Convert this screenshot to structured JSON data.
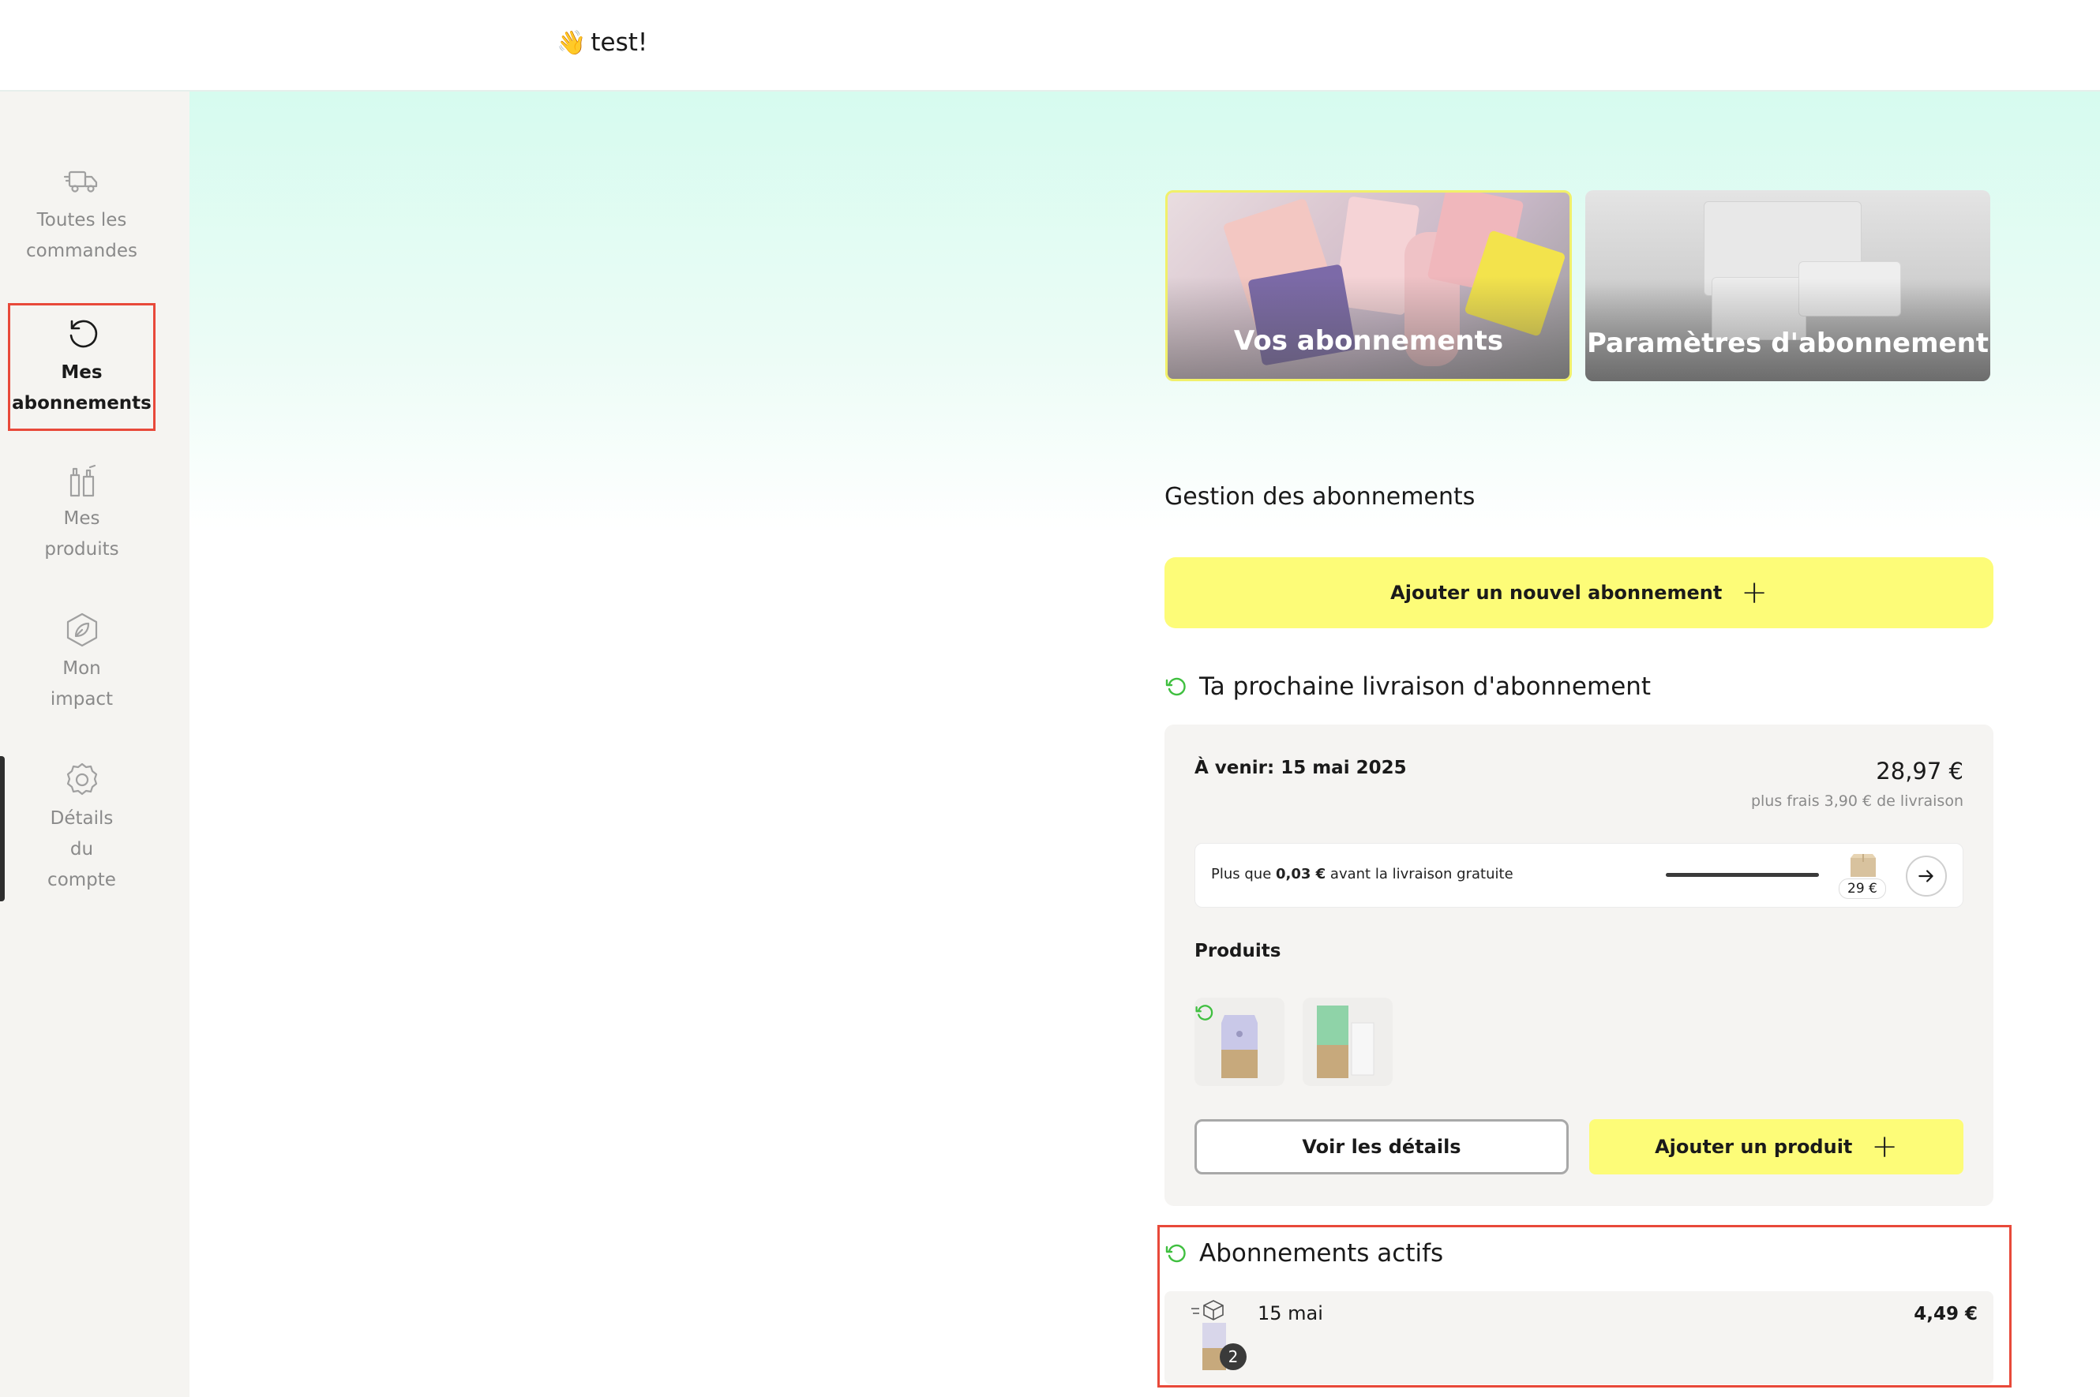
{
  "header": {
    "wave_emoji": "👋",
    "greeting": "test!"
  },
  "sidebar": {
    "items": [
      {
        "label": "Toutes les\ncommandes",
        "icon": "truck-icon",
        "active": false
      },
      {
        "label": "Mes\nabonnements",
        "icon": "refresh-icon",
        "active": true
      },
      {
        "label": "Mes\nproduits",
        "icon": "bottles-icon",
        "active": false
      },
      {
        "label": "Mon\nimpact",
        "icon": "leaf-icon",
        "active": false
      },
      {
        "label": "Détails\ndu\ncompte",
        "icon": "gear-icon",
        "active": false
      }
    ]
  },
  "hero_cards": [
    {
      "title": "Vos abonnements"
    },
    {
      "title": "Paramètres d'abonnement"
    }
  ],
  "management": {
    "title": "Gestion des abonnements",
    "add_subscription_label": "Ajouter un nouvel abonnement",
    "plus": "+"
  },
  "next_delivery": {
    "heading": "Ta prochaine livraison d'abonnement",
    "upcoming": "À venir: 15 mai 2025",
    "price": "28,97 €",
    "fees": "plus frais 3,90 € de livraison",
    "free_shipping": {
      "prefix": "Plus que ",
      "amount": "0,03 €",
      "suffix": " avant la livraison gratuite",
      "threshold": "29 €",
      "progress": 0.999
    },
    "products_label": "Produits",
    "view_details_label": "Voir les détails",
    "add_product_label": "Ajouter un produit"
  },
  "active_subscriptions": {
    "heading": "Abonnements actifs",
    "rows": [
      {
        "date": "15 mai",
        "price": "4,49 €",
        "quantity": "2"
      }
    ]
  },
  "colors": {
    "accent_yellow": "#fdfc78",
    "highlight_red": "#e8493a",
    "repeat_green": "#3fbf3f",
    "mint": "#d6fbef"
  }
}
